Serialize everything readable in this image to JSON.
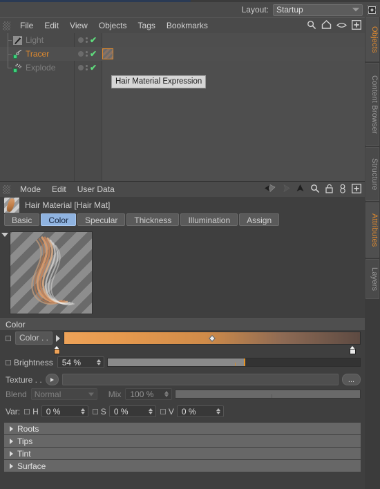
{
  "window": {
    "layout_label": "Layout:",
    "layout_value": "Startup",
    "corner_icon": "fullscreen-icon"
  },
  "object_manager": {
    "menu": [
      "File",
      "Edit",
      "View",
      "Objects",
      "Tags",
      "Bookmarks"
    ],
    "tool_icons": [
      "search-icon",
      "home-icon",
      "eye-icon",
      "plus-box-icon"
    ],
    "objects": [
      {
        "name": "Light",
        "selected": false,
        "icon": "light-object-icon",
        "visible_dot": "●",
        "check": "✔"
      },
      {
        "name": "Tracer",
        "selected": true,
        "icon": "tracer-object-icon",
        "visible_dot": "●",
        "check": "✔"
      },
      {
        "name": "Explode",
        "selected": false,
        "icon": "explode-object-icon",
        "visible_dot": "●",
        "check": "✔"
      }
    ],
    "tag_tooltip": "Hair Material Expression"
  },
  "attribute_manager": {
    "menu": [
      "Mode",
      "Edit",
      "User Data"
    ],
    "tool_icons": [
      "back-arrow-icon",
      "forward-arrow-icon",
      "up-arrow-icon",
      "search-icon",
      "unlock-icon",
      "pin-icon",
      "plus-box-icon"
    ],
    "material_title": "Hair Material [Hair Mat]",
    "tabs": [
      {
        "label": "Basic",
        "active": false
      },
      {
        "label": "Color",
        "active": true
      },
      {
        "label": "Specular",
        "active": false
      },
      {
        "label": "Thickness",
        "active": false
      },
      {
        "label": "Illumination",
        "active": false
      },
      {
        "label": "Assign",
        "active": false
      }
    ],
    "color_section": {
      "header": "Color",
      "color_label": "Color . .",
      "gradient_start": "#eda258",
      "gradient_end": "#5d4a42",
      "brightness_label": "Brightness",
      "brightness_value": "54 %",
      "brightness_percent": 54,
      "texture_label": "Texture  . .",
      "texture_value": "",
      "texture_browse": "...",
      "blend_label": "Blend",
      "blend_value": "Normal",
      "mix_label": "Mix",
      "mix_value": "100 %",
      "mix_percent": 100,
      "var_label": "Var:",
      "var_h_label": "H",
      "var_h_value": "0 %",
      "var_s_label": "S",
      "var_s_value": "0 %",
      "var_v_label": "V",
      "var_v_value": "0 %"
    },
    "fold_sections": [
      "Roots",
      "Tips",
      "Tint",
      "Surface"
    ]
  },
  "rail_tabs": [
    {
      "label": "Objects",
      "active": true
    },
    {
      "label": "Content Browser",
      "active": false
    },
    {
      "label": "Structure",
      "active": false
    },
    {
      "label": "Attributes",
      "active": true
    },
    {
      "label": "Layers",
      "active": false
    }
  ],
  "colors": {
    "accent_orange": "#e08a2e",
    "tab_active_blue": "#8fb3e0",
    "check_green": "#5fdc7d",
    "panel_bg": "#4a4a4a"
  }
}
